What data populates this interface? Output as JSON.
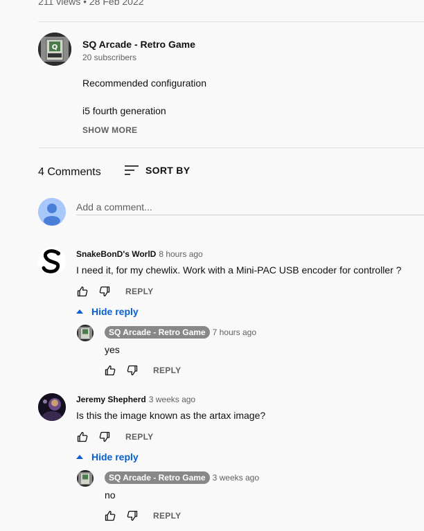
{
  "video": {
    "meta": "211 views • 28 Feb 2022"
  },
  "channel": {
    "name": "SQ Arcade - Retro Game",
    "subscribers": "20 subscribers",
    "description_lines": [
      "Recommended configuration",
      "i5 fourth generation"
    ],
    "show_more": "SHOW MORE"
  },
  "comments_header": {
    "count_label": "4 Comments",
    "sort_label": "SORT BY"
  },
  "add_comment": {
    "placeholder": "Add a comment..."
  },
  "comments": [
    {
      "author": "SnakeBonD's WorlD",
      "time": "8 hours ago",
      "text": "I need it, for my chewlix. Work with a Mini-PAC USB encoder for controller ?",
      "reply_label": "REPLY",
      "hide_reply_label": "Hide reply",
      "replies": [
        {
          "author": "SQ Arcade - Retro Game",
          "time": "7 hours ago",
          "text": "yes",
          "reply_label": "REPLY"
        }
      ]
    },
    {
      "author": "Jeremy Shepherd",
      "time": "3 weeks ago",
      "text": "Is this the image known as the artax image?",
      "reply_label": "REPLY",
      "hide_reply_label": "Hide reply",
      "replies": [
        {
          "author": "SQ Arcade - Retro Game",
          "time": "3 weeks ago",
          "text": "no",
          "reply_label": "REPLY"
        }
      ]
    }
  ],
  "icons": {
    "like": "thumbs-up-icon",
    "dislike": "thumbs-down-icon",
    "sort": "sort-icon",
    "caret": "caret-up-icon"
  },
  "colors": {
    "link_blue": "#065fd4",
    "chip_gray": "#888888",
    "secondary_text": "#606060"
  }
}
